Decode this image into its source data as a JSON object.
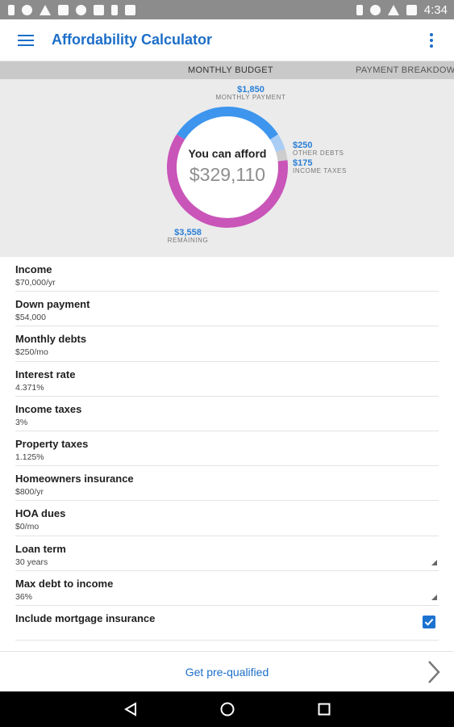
{
  "status_bar": {
    "time": "4:34",
    "left_icons": [
      "battery-saver-icon",
      "location-pin-icon",
      "warning-icon",
      "image-icon",
      "heart-icon",
      "g-plus-icon",
      "download-icon",
      "play-store-icon"
    ],
    "right_icons": [
      "bluetooth-icon",
      "sync-icon",
      "wifi-icon",
      "signal-icon"
    ]
  },
  "app_bar": {
    "title": "Affordability Calculator",
    "menu_icon": "hamburger-icon",
    "overflow_icon": "more-vert-icon"
  },
  "tabs": [
    {
      "label": "Monthly Budget",
      "active": true
    },
    {
      "label": "Payment Breakdown",
      "active": false
    }
  ],
  "summary": {
    "afford_label": "You can afford",
    "afford_value": "$329,110",
    "callouts": {
      "monthly_payment": {
        "value": "$1,850",
        "label": "Monthly Payment"
      },
      "other_debts": {
        "value": "$250",
        "label": "Other Debts"
      },
      "income_taxes": {
        "value": "$175",
        "label": "Income Taxes"
      },
      "remaining": {
        "value": "$3,558",
        "label": "Remaining"
      }
    },
    "segments": [
      {
        "name": "Monthly Payment",
        "amount": 1850,
        "color": "#3d95ee"
      },
      {
        "name": "Other Debts",
        "amount": 250,
        "color": "#a9cdf5"
      },
      {
        "name": "Income Taxes",
        "amount": 175,
        "color": "#cdcdcd"
      },
      {
        "name": "Remaining",
        "amount": 3558,
        "color": "#c955b9"
      }
    ]
  },
  "form": {
    "rows": [
      {
        "label": "Income",
        "value": "$70,000/yr"
      },
      {
        "label": "Down payment",
        "value": "$54,000"
      },
      {
        "label": "Monthly debts",
        "value": "$250/mo"
      },
      {
        "label": "Interest rate",
        "value": "4.371%"
      },
      {
        "label": "Income taxes",
        "value": "3%"
      },
      {
        "label": "Property taxes",
        "value": "1.125%"
      },
      {
        "label": "Homeowners insurance",
        "value": "$800/yr"
      },
      {
        "label": "HOA dues",
        "value": "$0/mo"
      },
      {
        "label": "Loan term",
        "value": "30 years"
      },
      {
        "label": "Max debt to income",
        "value": "36%"
      }
    ],
    "mortgage_insurance": {
      "label": "Include mortgage insurance",
      "checked": true
    }
  },
  "bottom_action": {
    "label": "Get pre-qualified"
  },
  "nav_bar": {
    "buttons": [
      "back-icon",
      "home-icon",
      "recents-icon"
    ]
  },
  "colors": {
    "accent": "#1c6ec8",
    "payment_blue": "#3d95ee",
    "remaining_pink": "#c955b9"
  }
}
